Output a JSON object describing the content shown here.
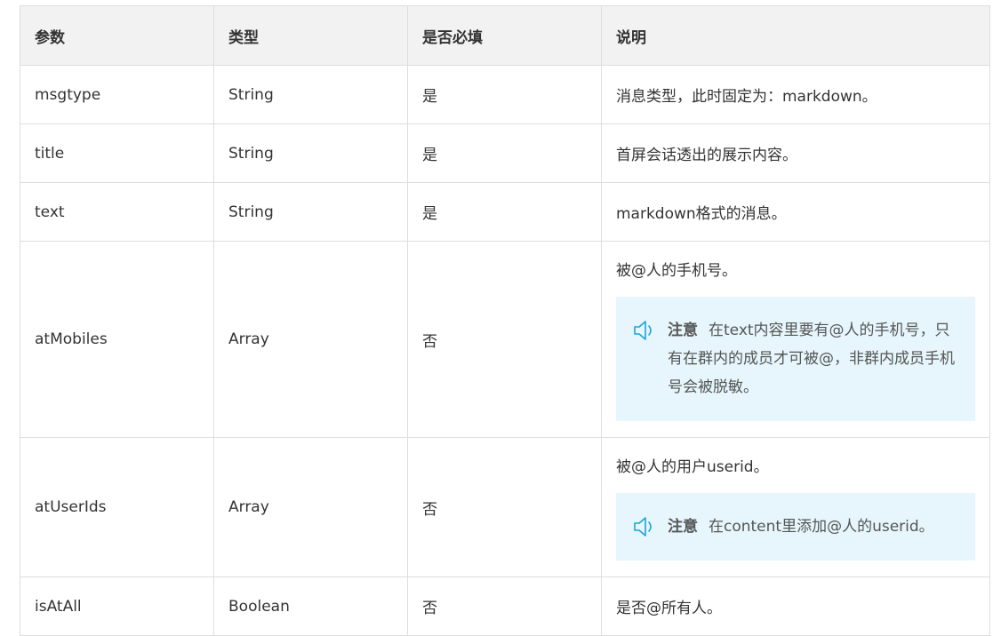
{
  "headers": [
    "参数",
    "类型",
    "是否必填",
    "说明"
  ],
  "rows": [
    {
      "param": "msgtype",
      "type": "String",
      "required": "是",
      "desc": "消息类型，此时固定为：markdown。"
    },
    {
      "param": "title",
      "type": "String",
      "required": "是",
      "desc": "首屏会话透出的展示内容。"
    },
    {
      "param": "text",
      "type": "String",
      "required": "是",
      "desc": "markdown格式的消息。"
    },
    {
      "param": "atMobiles",
      "type": "Array",
      "required": "否",
      "desc": "被@人的手机号。",
      "notice": {
        "icon": "speaker-icon",
        "label": "注意",
        "text": "在text内容里要有@人的手机号，只有在群内的成员才可被@，非群内成员手机号会被脱敏。"
      }
    },
    {
      "param": "atUserIds",
      "type": "Array",
      "required": "否",
      "desc": "被@人的用户userid。",
      "notice": {
        "icon": "speaker-icon",
        "label": "注意",
        "text": "在content里添加@人的userid。"
      }
    },
    {
      "param": "isAtAll",
      "type": "Boolean",
      "required": "否",
      "desc": "是否@所有人。"
    }
  ],
  "colors": {
    "header_bg": "#f2f2f2",
    "border": "#dedede",
    "notice_bg": "#e6f6fc",
    "icon": "#1aa4d8"
  }
}
